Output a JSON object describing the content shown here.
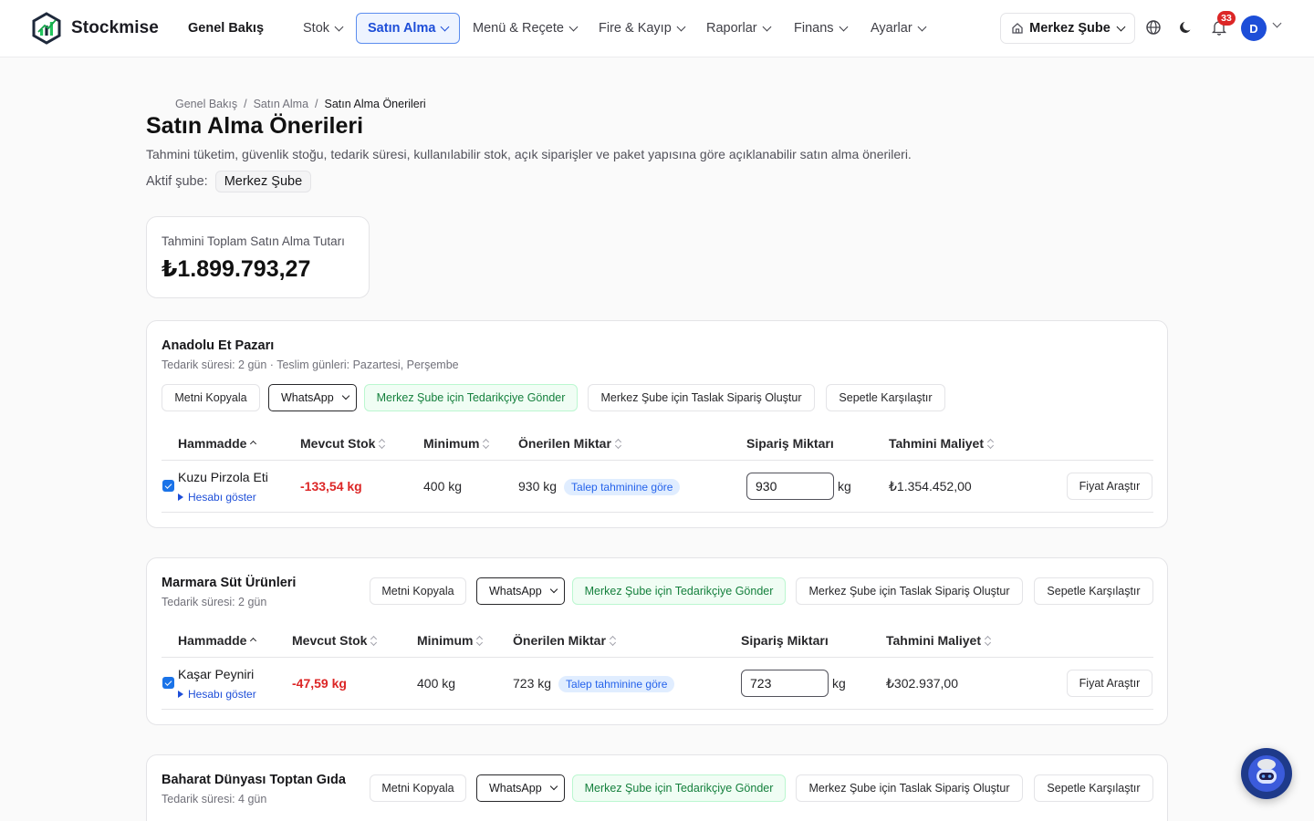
{
  "brand": {
    "name": "Stockmise"
  },
  "nav": {
    "home": "Genel Bakış",
    "stok": "Stok",
    "satin_alma": "Satın Alma",
    "menu": "Menü & Reçete",
    "fire": "Fire & Kayıp",
    "raporlar": "Raporlar",
    "finans": "Finans",
    "ayarlar": "Ayarlar"
  },
  "topbar": {
    "branch": "Merkez Şube",
    "notification_count": "33",
    "avatar_initial": "D",
    "icons": [
      "home-icon",
      "globe-icon",
      "moon-icon",
      "bell-icon"
    ]
  },
  "breadcrumb": {
    "item1": "Genel Bakış",
    "sep1": "/",
    "item2": "Satın Alma",
    "sep2": "/",
    "current": "Satın Alma Önerileri"
  },
  "page": {
    "title": "Satın Alma Önerileri",
    "description": "Tahmini tüketim, güvenlik stoğu, tedarik süresi, kullanılabilir stok, açık siparişler ve paket yapısına göre açıklanabilir satın alma önerileri.",
    "active_branch_label": "Aktif şube:",
    "active_branch": "Merkez Şube"
  },
  "summary": {
    "label": "Tahmini Toplam Satın Alma Tutarı",
    "value": "₺1.899.793,27"
  },
  "actions": {
    "copy": "Metni Kopyala",
    "channel": "WhatsApp",
    "send": "Merkez Şube için Tedarikçiye Gönder",
    "draft": "Merkez Şube için Taslak Sipariş Oluştur",
    "compare": "Sepetle Karşılaştır",
    "price": "Fiyat Araştır",
    "show_calc": "Hesabı göster"
  },
  "table_headers": {
    "material": "Hammadde",
    "stock": "Mevcut Stok",
    "minimum": "Minimum",
    "suggested": "Önerilen Miktar",
    "order": "Sipariş Miktarı",
    "cost": "Tahmini Maliyet"
  },
  "suppliers": [
    {
      "name": "Anadolu Et Pazarı",
      "meta": "Tedarik süresi: 2 gün · Teslim günleri: Pazartesi, Perşembe",
      "rows": [
        {
          "name": "Kuzu Pirzola Eti",
          "stock": "-133,54 kg",
          "minimum": "400 kg",
          "suggested": "930 kg",
          "basis": "Talep tahminine göre",
          "order_qty": "930",
          "unit": "kg",
          "cost": "₺1.354.452,00",
          "checked": true
        }
      ]
    },
    {
      "name": "Marmara Süt Ürünleri",
      "meta": "Tedarik süresi: 2 gün",
      "rows": [
        {
          "name": "Kaşar Peyniri",
          "stock": "-47,59 kg",
          "minimum": "400 kg",
          "suggested": "723 kg",
          "basis": "Talep tahminine göre",
          "order_qty": "723",
          "unit": "kg",
          "cost": "₺302.937,00",
          "checked": true
        }
      ]
    },
    {
      "name": "Baharat Dünyası Toptan Gıda",
      "meta": "Tedarik süresi: 4 gün",
      "rows": []
    }
  ],
  "colors": {
    "accent": "#1d4ed8",
    "negative": "#dc2626",
    "send_green": "#15803d",
    "pill_bg": "#e0edff"
  }
}
